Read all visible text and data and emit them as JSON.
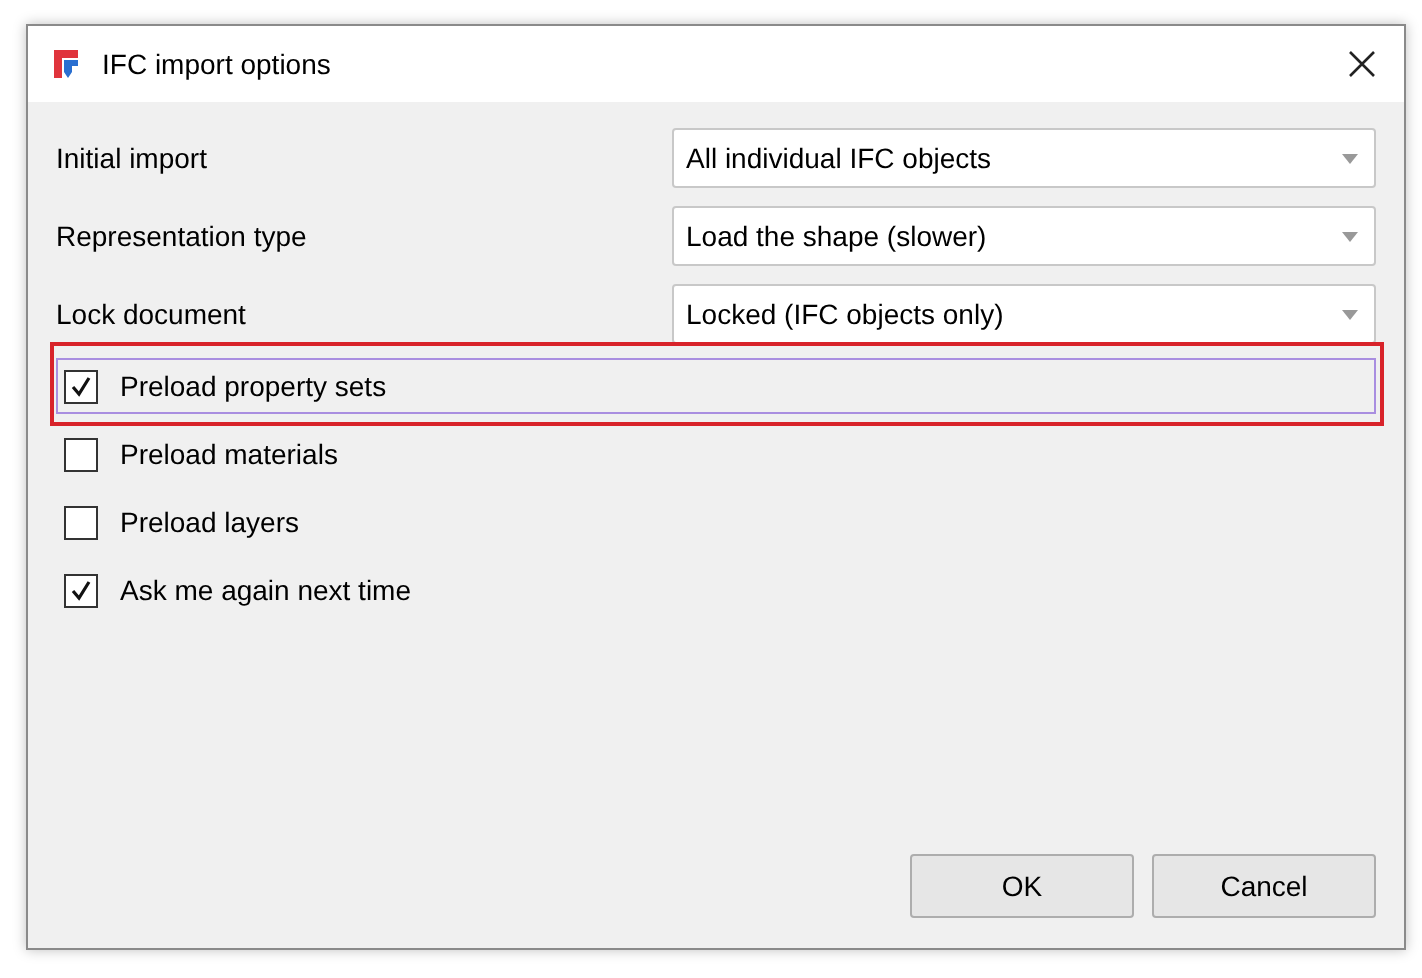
{
  "window": {
    "title": "IFC import options"
  },
  "fields": [
    {
      "label": "Initial import",
      "value": "All individual IFC objects"
    },
    {
      "label": "Representation type",
      "value": "Load the shape (slower)"
    },
    {
      "label": "Lock document",
      "value": "Locked (IFC objects only)"
    }
  ],
  "checkboxes": [
    {
      "label": "Preload property sets",
      "checked": true,
      "focused": true,
      "highlighted": true
    },
    {
      "label": "Preload materials",
      "checked": false,
      "focused": false,
      "highlighted": false
    },
    {
      "label": "Preload layers",
      "checked": false,
      "focused": false,
      "highlighted": false
    },
    {
      "label": "Ask me again next time",
      "checked": true,
      "focused": false,
      "highlighted": false
    }
  ],
  "buttons": [
    {
      "label": "OK"
    },
    {
      "label": "Cancel"
    }
  ]
}
